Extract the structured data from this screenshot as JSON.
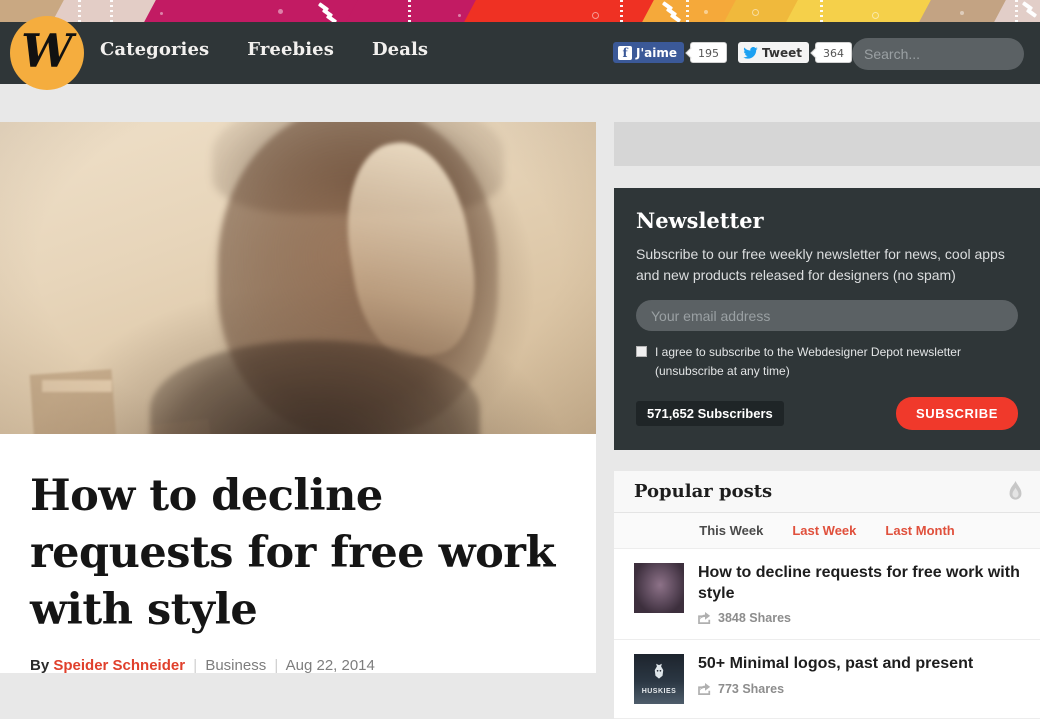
{
  "header": {
    "logo_letter": "W",
    "logo_icon": "wdd-logo-icon",
    "nav": [
      {
        "label": "Categories"
      },
      {
        "label": "Freebies"
      },
      {
        "label": "Deals"
      }
    ],
    "social": {
      "facebook": {
        "label": "J'aime",
        "count": "195",
        "icon": "facebook-icon"
      },
      "twitter": {
        "label": "Tweet",
        "count": "364",
        "icon": "twitter-bird-icon"
      }
    },
    "search": {
      "placeholder": "Search...",
      "value": "",
      "icon": "search-icon"
    },
    "colors": {
      "bar": "#2f3638",
      "logo": "#f5ad3e",
      "accent": "#e0402c"
    }
  },
  "ribbon": {
    "name": "decorative-pattern-banner",
    "colors": [
      "#c9a882",
      "#e3cdc6",
      "#c21b63",
      "#ef3123",
      "#f5a93a",
      "#f0b93c",
      "#f5d04a",
      "#c3a383",
      "#e2cec8"
    ]
  },
  "article": {
    "hero_alt": "man-with-hand-on-forehead-photo",
    "title": "How to decline requests for free work with style",
    "by_label": "By",
    "author": "Speider Schneider",
    "category": "Business",
    "date": "Aug 22, 2014",
    "separator": "|"
  },
  "sidebar": {
    "ad_placeholder": "",
    "newsletter": {
      "title": "Newsletter",
      "description": "Subscribe to our free weekly newsletter for news, cool apps and new products released for designers (no spam)",
      "email_placeholder": "Your email address",
      "email_value": "",
      "agree_text": "I agree to subscribe to the Webdesigner Depot newsletter (unsubscribe at any time)",
      "agree_checked": false,
      "subscribers": "571,652 Subscribers",
      "subscribe_label": "SUBSCRIBE",
      "button_color": "#f0392b"
    },
    "popular": {
      "title": "Popular posts",
      "icon": "flame-icon",
      "tabs": [
        {
          "label": "This Week",
          "active": true
        },
        {
          "label": "Last Week",
          "active": false
        },
        {
          "label": "Last Month",
          "active": false
        }
      ],
      "posts": [
        {
          "title": "How to decline requests for free work with style",
          "shares": "3848 Shares",
          "thumb": "portrait-thumbnail",
          "share_icon": "share-icon"
        },
        {
          "title": "50+ Minimal logos, past and present",
          "shares": "773 Shares",
          "thumb": "huskies-logo-thumbnail",
          "thumb_text": "HUSKIES",
          "share_icon": "share-icon"
        }
      ]
    }
  }
}
